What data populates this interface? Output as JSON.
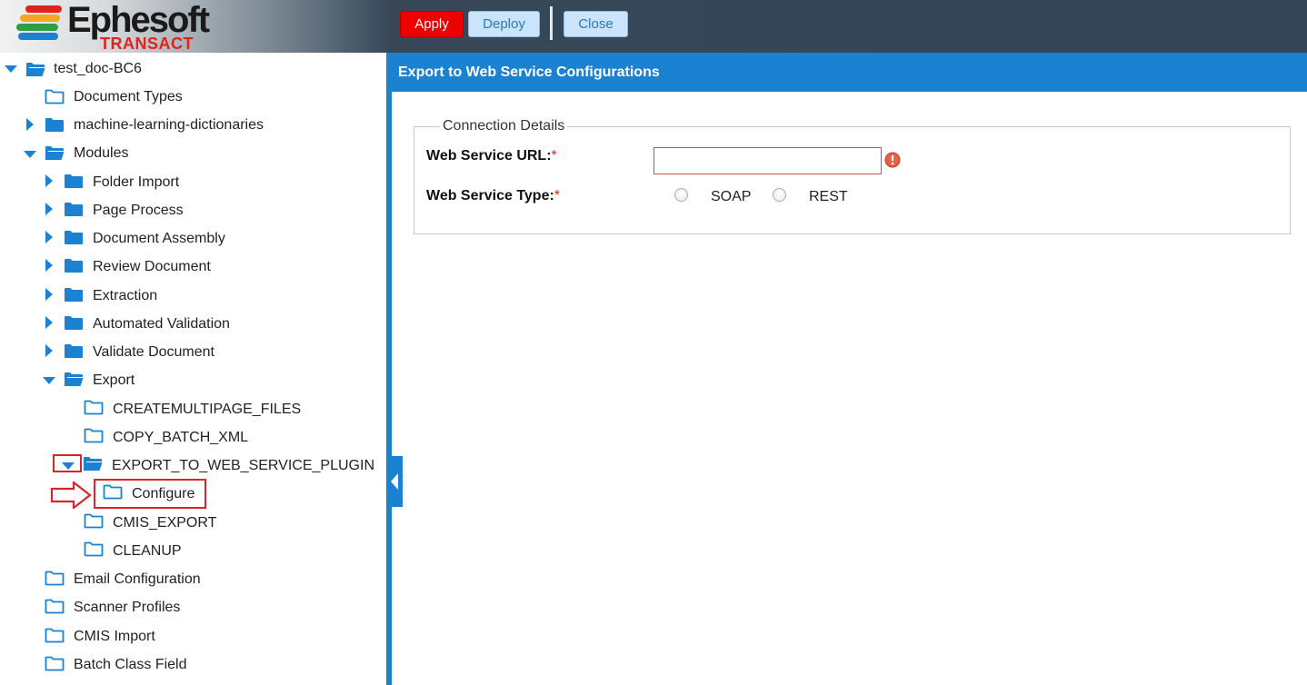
{
  "header": {
    "logo": {
      "brand": "Ephesoft",
      "sub": "TRANSACT"
    },
    "apply_label": "Apply",
    "deploy_label": "Deploy",
    "close_label": "Close"
  },
  "tree": {
    "root": "test_doc-BC6",
    "document_types": "Document Types",
    "ml_dictionaries": "machine-learning-dictionaries",
    "modules": "Modules",
    "folder_import": "Folder Import",
    "page_process": "Page Process",
    "document_assembly": "Document Assembly",
    "review_document": "Review Document",
    "extraction": "Extraction",
    "automated_validation": "Automated Validation",
    "validate_document": "Validate Document",
    "export": "Export",
    "createmultipage_files": "CREATEMULTIPAGE_FILES",
    "copy_batch_xml": "COPY_BATCH_XML",
    "export_to_web_service_plugin": "EXPORT_TO_WEB_SERVICE_PLUGIN",
    "configure": "Configure",
    "cmis_export": "CMIS_EXPORT",
    "cleanup": "CLEANUP",
    "email_configuration": "Email Configuration",
    "scanner_profiles": "Scanner Profiles",
    "cmis_import": "CMIS Import",
    "batch_class_field": "Batch Class Field"
  },
  "panel": {
    "title": "Export to Web Service Configurations",
    "legend": "Connection Details",
    "url_label": "Web Service URL:",
    "type_label": "Web Service Type:",
    "required_mark": "*",
    "url_value": "",
    "type_options": [
      "SOAP",
      "REST"
    ]
  },
  "colors": {
    "accent": "#1a82d0",
    "apply": "#ee0000",
    "highlight": "#d9232d"
  }
}
